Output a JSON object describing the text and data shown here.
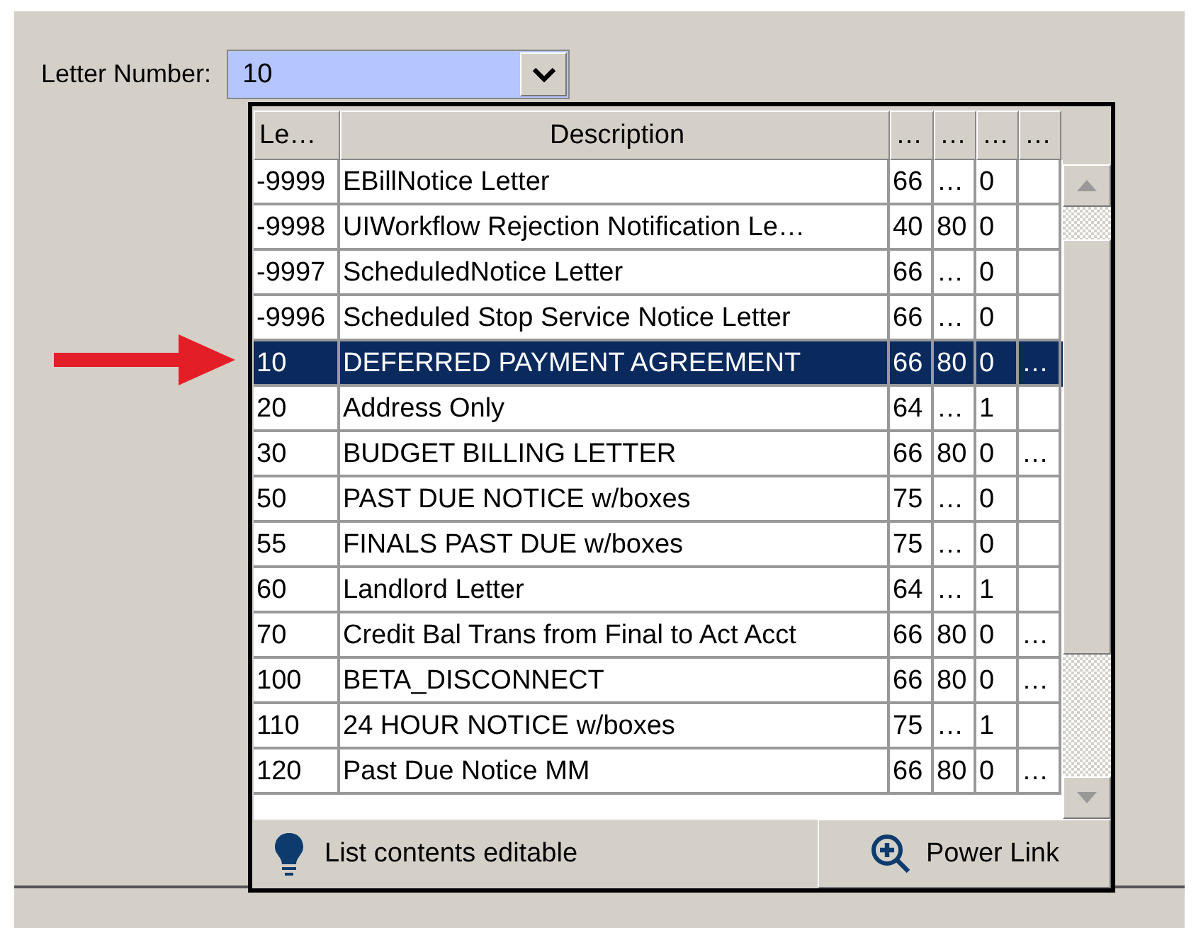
{
  "field": {
    "label": "Letter Number:",
    "value": "10"
  },
  "table": {
    "columns": [
      "Le…",
      "Description",
      "…",
      "…",
      "…",
      "…"
    ],
    "rows": [
      {
        "cells": [
          "-9999",
          "EBillNotice Letter",
          "66",
          "…",
          "0",
          ""
        ],
        "selected": false
      },
      {
        "cells": [
          "-9998",
          "UIWorkflow Rejection Notification Le…",
          "40",
          "80",
          "0",
          ""
        ],
        "selected": false
      },
      {
        "cells": [
          "-9997",
          "ScheduledNotice Letter",
          "66",
          "…",
          "0",
          ""
        ],
        "selected": false
      },
      {
        "cells": [
          "-9996",
          "Scheduled Stop Service Notice Letter",
          "66",
          "…",
          "0",
          ""
        ],
        "selected": false
      },
      {
        "cells": [
          "10",
          "DEFERRED PAYMENT AGREEMENT",
          "66",
          "80",
          "0",
          "…"
        ],
        "selected": true
      },
      {
        "cells": [
          "20",
          "Address Only",
          "64",
          "…",
          "1",
          ""
        ],
        "selected": false
      },
      {
        "cells": [
          "30",
          "BUDGET BILLING LETTER",
          "66",
          "80",
          "0",
          "…"
        ],
        "selected": false
      },
      {
        "cells": [
          "50",
          "PAST DUE NOTICE w/boxes",
          "75",
          "…",
          "0",
          ""
        ],
        "selected": false
      },
      {
        "cells": [
          "55",
          "FINALS PAST DUE w/boxes",
          "75",
          "…",
          "0",
          ""
        ],
        "selected": false
      },
      {
        "cells": [
          "60",
          "Landlord Letter",
          "64",
          "…",
          "1",
          ""
        ],
        "selected": false
      },
      {
        "cells": [
          "70",
          "Credit Bal Trans from Final to Act Acct",
          "66",
          "80",
          "0",
          "…"
        ],
        "selected": false
      },
      {
        "cells": [
          "100",
          "BETA_DISCONNECT",
          "66",
          "80",
          "0",
          "…"
        ],
        "selected": false
      },
      {
        "cells": [
          "110",
          "24 HOUR NOTICE w/boxes",
          "75",
          "…",
          "1",
          ""
        ],
        "selected": false
      },
      {
        "cells": [
          "120",
          "Past Due Notice MM",
          "66",
          "80",
          "0",
          "…"
        ],
        "selected": false
      }
    ]
  },
  "footer": {
    "hint": "List contents editable",
    "button": "Power Link"
  }
}
